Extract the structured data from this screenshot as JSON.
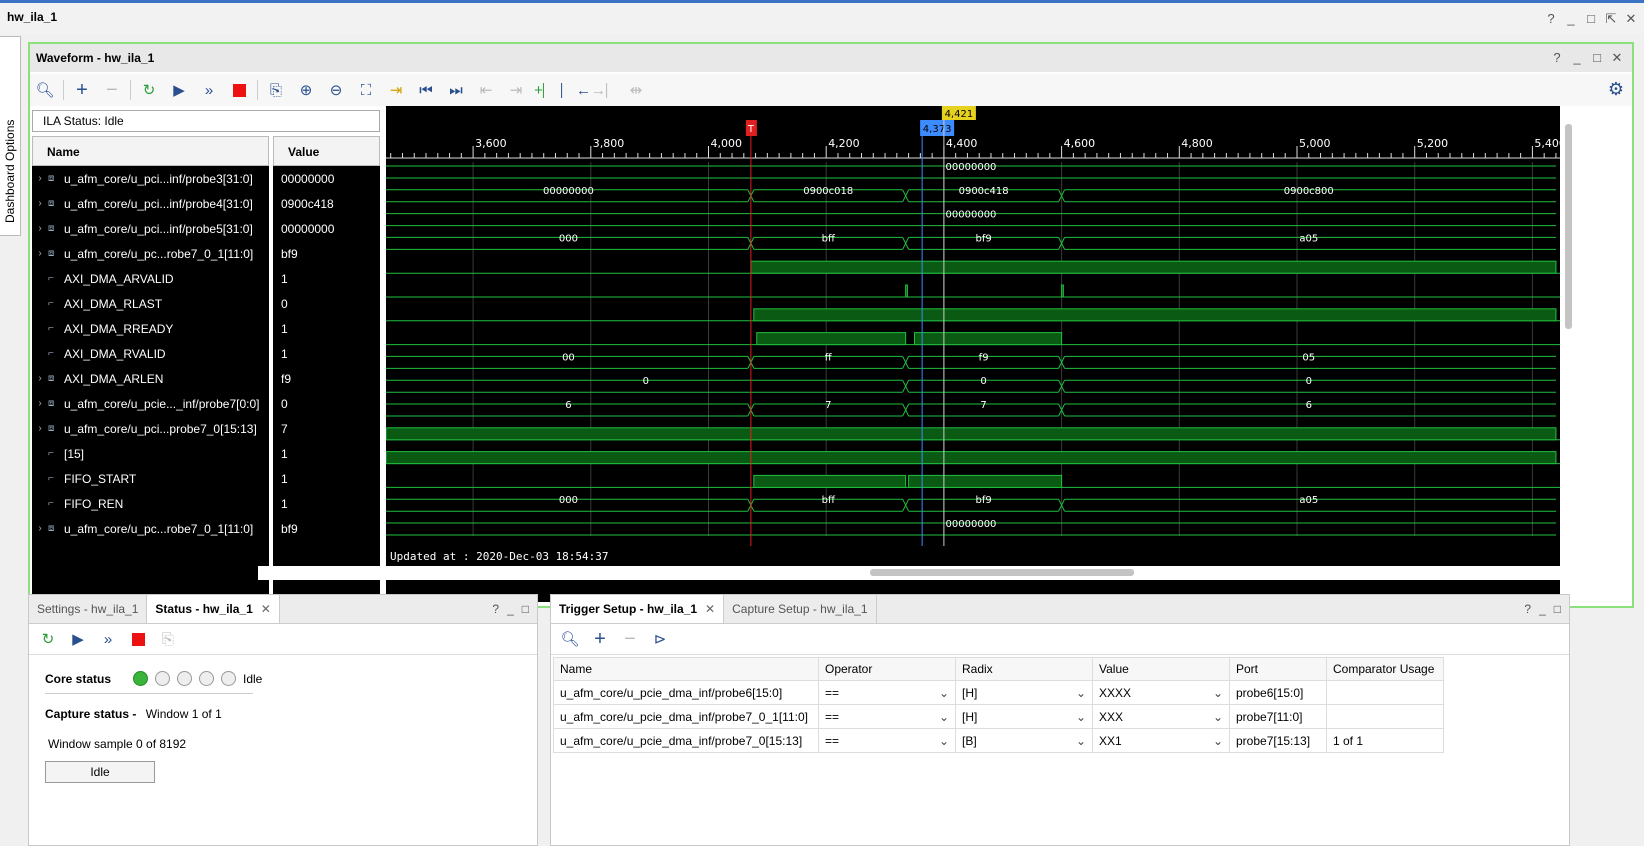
{
  "window": {
    "title": "hw_ila_1",
    "controls": [
      "?",
      "_",
      "□",
      "⇱",
      "✕"
    ]
  },
  "side_tab": {
    "label": "Dashboard Options"
  },
  "waveform": {
    "title": "Waveform - hw_ila_1",
    "ila_status": "ILA Status:  Idle",
    "col_name": "Name",
    "col_value": "Value",
    "updated": "Updated at : 2020-Dec-03 18:54:37",
    "cursor_main": "4,421",
    "cursor_blue": "4,373",
    "trigger_marker": "T",
    "ticks": [
      "3,600",
      "3,800",
      "4,000",
      "4,200",
      "4,400",
      "4,600",
      "4,800",
      "5,000",
      "5,200",
      "5,400"
    ],
    "signals": [
      {
        "name": "u_afm_core/u_pci...inf/probe3[31:0]",
        "value": "00000000",
        "bus": true
      },
      {
        "name": "u_afm_core/u_pci...inf/probe4[31:0]",
        "value": "0900c418",
        "bus": true
      },
      {
        "name": "u_afm_core/u_pci...inf/probe5[31:0]",
        "value": "00000000",
        "bus": true
      },
      {
        "name": "u_afm_core/u_pc...robe7_0_1[11:0]",
        "value": "bf9",
        "bus": true
      },
      {
        "name": "AXI_DMA_ARVALID",
        "value": "1",
        "bus": false
      },
      {
        "name": "AXI_DMA_RLAST",
        "value": "0",
        "bus": false
      },
      {
        "name": "AXI_DMA_RREADY",
        "value": "1",
        "bus": false
      },
      {
        "name": "AXI_DMA_RVALID",
        "value": "1",
        "bus": false
      },
      {
        "name": "AXI_DMA_ARLEN",
        "value": "f9",
        "bus": true
      },
      {
        "name": "u_afm_core/u_pcie..._inf/probe7[0:0]",
        "value": "0",
        "bus": true
      },
      {
        "name": "u_afm_core/u_pci...probe7_0[15:13]",
        "value": "7",
        "bus": true
      },
      {
        "name": "[15]",
        "value": "1",
        "bus": false
      },
      {
        "name": "FIFO_START",
        "value": "1",
        "bus": false
      },
      {
        "name": "FIFO_REN",
        "value": "1",
        "bus": false
      },
      {
        "name": "u_afm_core/u_pc...robe7_0_1[11:0]",
        "value": "bf9",
        "bus": true
      },
      {
        "name": "u_afm_core/u_pci...inf/probe3[31:0]",
        "value": "00000000",
        "bus": true
      }
    ],
    "bus_labels": {
      "r0": [
        "00000000"
      ],
      "r1": [
        "00000000",
        "0900c018",
        "0900c418",
        "0900c800"
      ],
      "r2": [
        "00000000"
      ],
      "r3": [
        "000",
        "bff",
        "bf9",
        "a05"
      ],
      "r8": [
        "00",
        "ff",
        "f9",
        "05"
      ],
      "r9": [
        "0",
        "0",
        "0"
      ],
      "r10": [
        "6",
        "7",
        "7",
        "6"
      ],
      "r14": [
        "000",
        "bff",
        "bf9",
        "a05"
      ],
      "r15": [
        "00000000"
      ]
    }
  },
  "status_panel": {
    "tabs": [
      "Settings - hw_ila_1",
      "Status - hw_ila_1"
    ],
    "core_status_label": "Core status",
    "core_status_value": "Idle",
    "capture_status_label": "Capture status -",
    "capture_status_value": "Window 1 of 1",
    "window_sample": "Window sample 0 of 8192",
    "idle_button": "Idle"
  },
  "trigger_panel": {
    "tabs": [
      "Trigger Setup - hw_ila_1",
      "Capture Setup - hw_ila_1"
    ],
    "columns": [
      "Name",
      "Operator",
      "Radix",
      "Value",
      "Port",
      "Comparator Usage"
    ],
    "rows": [
      {
        "name": "u_afm_core/u_pcie_dma_inf/probe6[15:0]",
        "operator": "==",
        "radix": "[H]",
        "value": "XXXX",
        "port": "probe6[15:0]",
        "usage": ""
      },
      {
        "name": "u_afm_core/u_pcie_dma_inf/probe7_0_1[11:0]",
        "operator": "==",
        "radix": "[H]",
        "value": "XXX",
        "port": "probe7[11:0]",
        "usage": ""
      },
      {
        "name": "u_afm_core/u_pcie_dma_inf/probe7_0[15:13]",
        "operator": "==",
        "radix": "[B]",
        "value": "XX1",
        "port": "probe7[15:13]",
        "usage": "1 of 1"
      }
    ]
  }
}
